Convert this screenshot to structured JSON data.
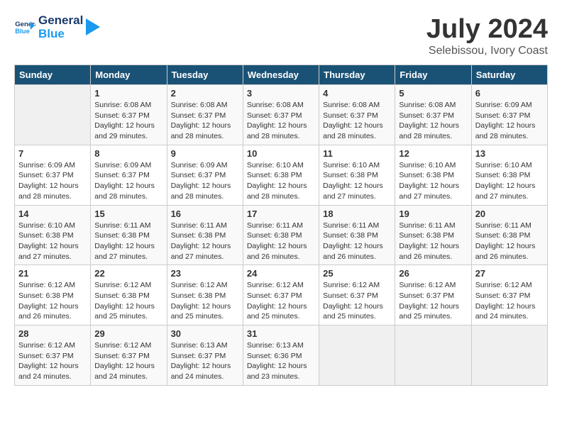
{
  "header": {
    "logo_line1": "General",
    "logo_line2": "Blue",
    "month_year": "July 2024",
    "location": "Selebissou, Ivory Coast"
  },
  "days_of_week": [
    "Sunday",
    "Monday",
    "Tuesday",
    "Wednesday",
    "Thursday",
    "Friday",
    "Saturday"
  ],
  "weeks": [
    [
      {
        "day": "",
        "info": ""
      },
      {
        "day": "1",
        "info": "Sunrise: 6:08 AM\nSunset: 6:37 PM\nDaylight: 12 hours\nand 29 minutes."
      },
      {
        "day": "2",
        "info": "Sunrise: 6:08 AM\nSunset: 6:37 PM\nDaylight: 12 hours\nand 28 minutes."
      },
      {
        "day": "3",
        "info": "Sunrise: 6:08 AM\nSunset: 6:37 PM\nDaylight: 12 hours\nand 28 minutes."
      },
      {
        "day": "4",
        "info": "Sunrise: 6:08 AM\nSunset: 6:37 PM\nDaylight: 12 hours\nand 28 minutes."
      },
      {
        "day": "5",
        "info": "Sunrise: 6:08 AM\nSunset: 6:37 PM\nDaylight: 12 hours\nand 28 minutes."
      },
      {
        "day": "6",
        "info": "Sunrise: 6:09 AM\nSunset: 6:37 PM\nDaylight: 12 hours\nand 28 minutes."
      }
    ],
    [
      {
        "day": "7",
        "info": "Sunrise: 6:09 AM\nSunset: 6:37 PM\nDaylight: 12 hours\nand 28 minutes."
      },
      {
        "day": "8",
        "info": "Sunrise: 6:09 AM\nSunset: 6:37 PM\nDaylight: 12 hours\nand 28 minutes."
      },
      {
        "day": "9",
        "info": "Sunrise: 6:09 AM\nSunset: 6:37 PM\nDaylight: 12 hours\nand 28 minutes."
      },
      {
        "day": "10",
        "info": "Sunrise: 6:10 AM\nSunset: 6:38 PM\nDaylight: 12 hours\nand 28 minutes."
      },
      {
        "day": "11",
        "info": "Sunrise: 6:10 AM\nSunset: 6:38 PM\nDaylight: 12 hours\nand 27 minutes."
      },
      {
        "day": "12",
        "info": "Sunrise: 6:10 AM\nSunset: 6:38 PM\nDaylight: 12 hours\nand 27 minutes."
      },
      {
        "day": "13",
        "info": "Sunrise: 6:10 AM\nSunset: 6:38 PM\nDaylight: 12 hours\nand 27 minutes."
      }
    ],
    [
      {
        "day": "14",
        "info": "Sunrise: 6:10 AM\nSunset: 6:38 PM\nDaylight: 12 hours\nand 27 minutes."
      },
      {
        "day": "15",
        "info": "Sunrise: 6:11 AM\nSunset: 6:38 PM\nDaylight: 12 hours\nand 27 minutes."
      },
      {
        "day": "16",
        "info": "Sunrise: 6:11 AM\nSunset: 6:38 PM\nDaylight: 12 hours\nand 27 minutes."
      },
      {
        "day": "17",
        "info": "Sunrise: 6:11 AM\nSunset: 6:38 PM\nDaylight: 12 hours\nand 26 minutes."
      },
      {
        "day": "18",
        "info": "Sunrise: 6:11 AM\nSunset: 6:38 PM\nDaylight: 12 hours\nand 26 minutes."
      },
      {
        "day": "19",
        "info": "Sunrise: 6:11 AM\nSunset: 6:38 PM\nDaylight: 12 hours\nand 26 minutes."
      },
      {
        "day": "20",
        "info": "Sunrise: 6:11 AM\nSunset: 6:38 PM\nDaylight: 12 hours\nand 26 minutes."
      }
    ],
    [
      {
        "day": "21",
        "info": "Sunrise: 6:12 AM\nSunset: 6:38 PM\nDaylight: 12 hours\nand 26 minutes."
      },
      {
        "day": "22",
        "info": "Sunrise: 6:12 AM\nSunset: 6:38 PM\nDaylight: 12 hours\nand 25 minutes."
      },
      {
        "day": "23",
        "info": "Sunrise: 6:12 AM\nSunset: 6:38 PM\nDaylight: 12 hours\nand 25 minutes."
      },
      {
        "day": "24",
        "info": "Sunrise: 6:12 AM\nSunset: 6:37 PM\nDaylight: 12 hours\nand 25 minutes."
      },
      {
        "day": "25",
        "info": "Sunrise: 6:12 AM\nSunset: 6:37 PM\nDaylight: 12 hours\nand 25 minutes."
      },
      {
        "day": "26",
        "info": "Sunrise: 6:12 AM\nSunset: 6:37 PM\nDaylight: 12 hours\nand 25 minutes."
      },
      {
        "day": "27",
        "info": "Sunrise: 6:12 AM\nSunset: 6:37 PM\nDaylight: 12 hours\nand 24 minutes."
      }
    ],
    [
      {
        "day": "28",
        "info": "Sunrise: 6:12 AM\nSunset: 6:37 PM\nDaylight: 12 hours\nand 24 minutes."
      },
      {
        "day": "29",
        "info": "Sunrise: 6:12 AM\nSunset: 6:37 PM\nDaylight: 12 hours\nand 24 minutes."
      },
      {
        "day": "30",
        "info": "Sunrise: 6:13 AM\nSunset: 6:37 PM\nDaylight: 12 hours\nand 24 minutes."
      },
      {
        "day": "31",
        "info": "Sunrise: 6:13 AM\nSunset: 6:36 PM\nDaylight: 12 hours\nand 23 minutes."
      },
      {
        "day": "",
        "info": ""
      },
      {
        "day": "",
        "info": ""
      },
      {
        "day": "",
        "info": ""
      }
    ]
  ]
}
